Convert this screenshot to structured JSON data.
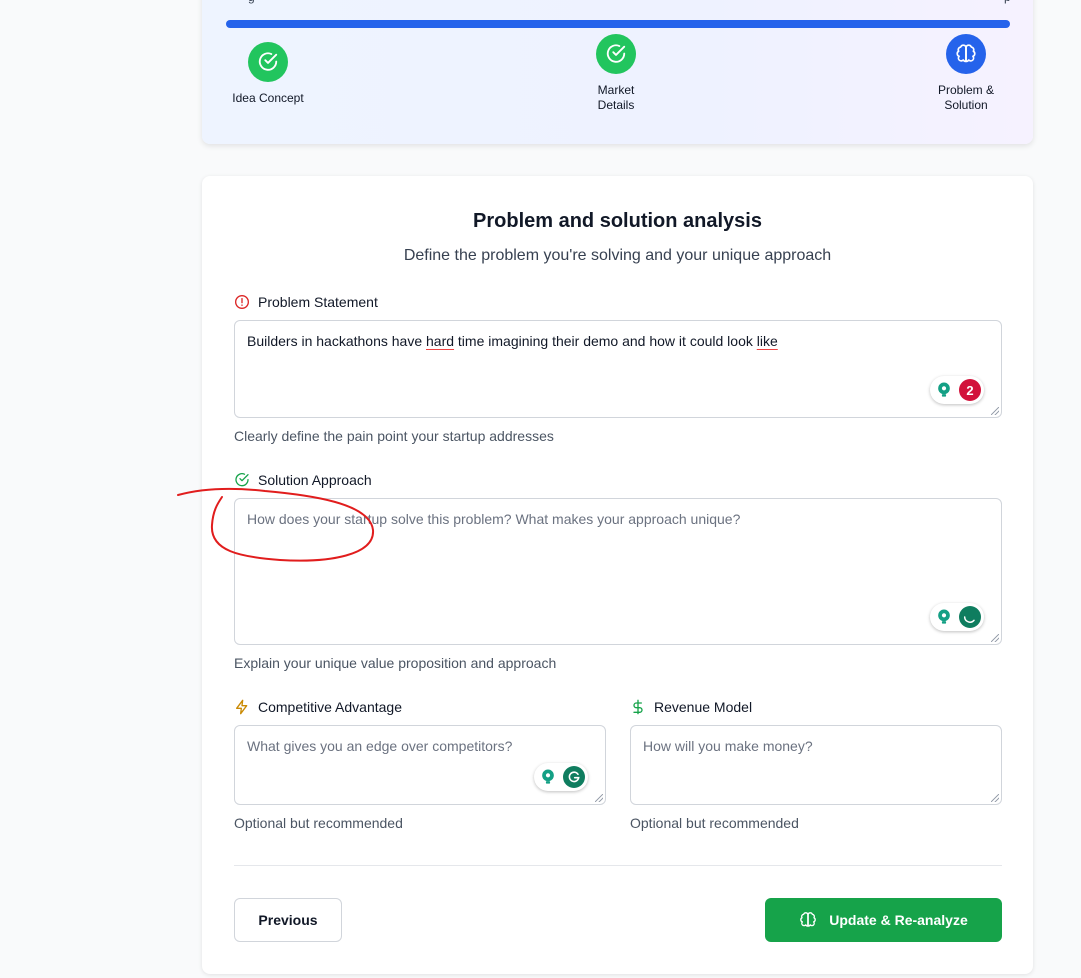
{
  "progress": {
    "value_percent": 100,
    "bar_color": "#2563eb",
    "cut_left": "g",
    "cut_right": "p",
    "steps": [
      {
        "label": "Idea Concept",
        "state": "done",
        "icon": "check-circle-icon"
      },
      {
        "label": "Market\nDetails",
        "state": "done",
        "icon": "check-circle-icon"
      },
      {
        "label": "Problem &\nSolution",
        "state": "active",
        "icon": "brain-icon"
      }
    ]
  },
  "form": {
    "title": "Problem and solution analysis",
    "subtitle": "Define the problem you're solving and your unique approach",
    "problem": {
      "label": "Problem Statement",
      "icon": "alert-circle-icon",
      "value_parts": [
        "Builders in hackathons have ",
        "hard",
        " time imagining their demo and how it could look ",
        "like"
      ],
      "helper": "Clearly define the pain point your startup addresses",
      "grammarly_count": "2"
    },
    "solution": {
      "label": "Solution Approach",
      "icon": "check-circle-icon",
      "placeholder": "How does your startup solve this problem? What makes your approach unique?",
      "helper": "Explain your unique value proposition and approach"
    },
    "competitive": {
      "label": "Competitive Advantage",
      "icon": "lightning-icon",
      "placeholder": "What gives you an edge over competitors?",
      "helper": "Optional but recommended"
    },
    "revenue": {
      "label": "Revenue Model",
      "icon": "dollar-icon",
      "placeholder": "How will you make money?",
      "helper": "Optional but recommended"
    }
  },
  "buttons": {
    "previous": "Previous",
    "update": "Update & Re-analyze"
  },
  "colors": {
    "accent_blue": "#2563eb",
    "success_green": "#22c55e",
    "button_green": "#16a34a",
    "alert_red": "#dc2626",
    "warning_amber": "#ca8a04",
    "annotation_red": "#e11d1d"
  }
}
